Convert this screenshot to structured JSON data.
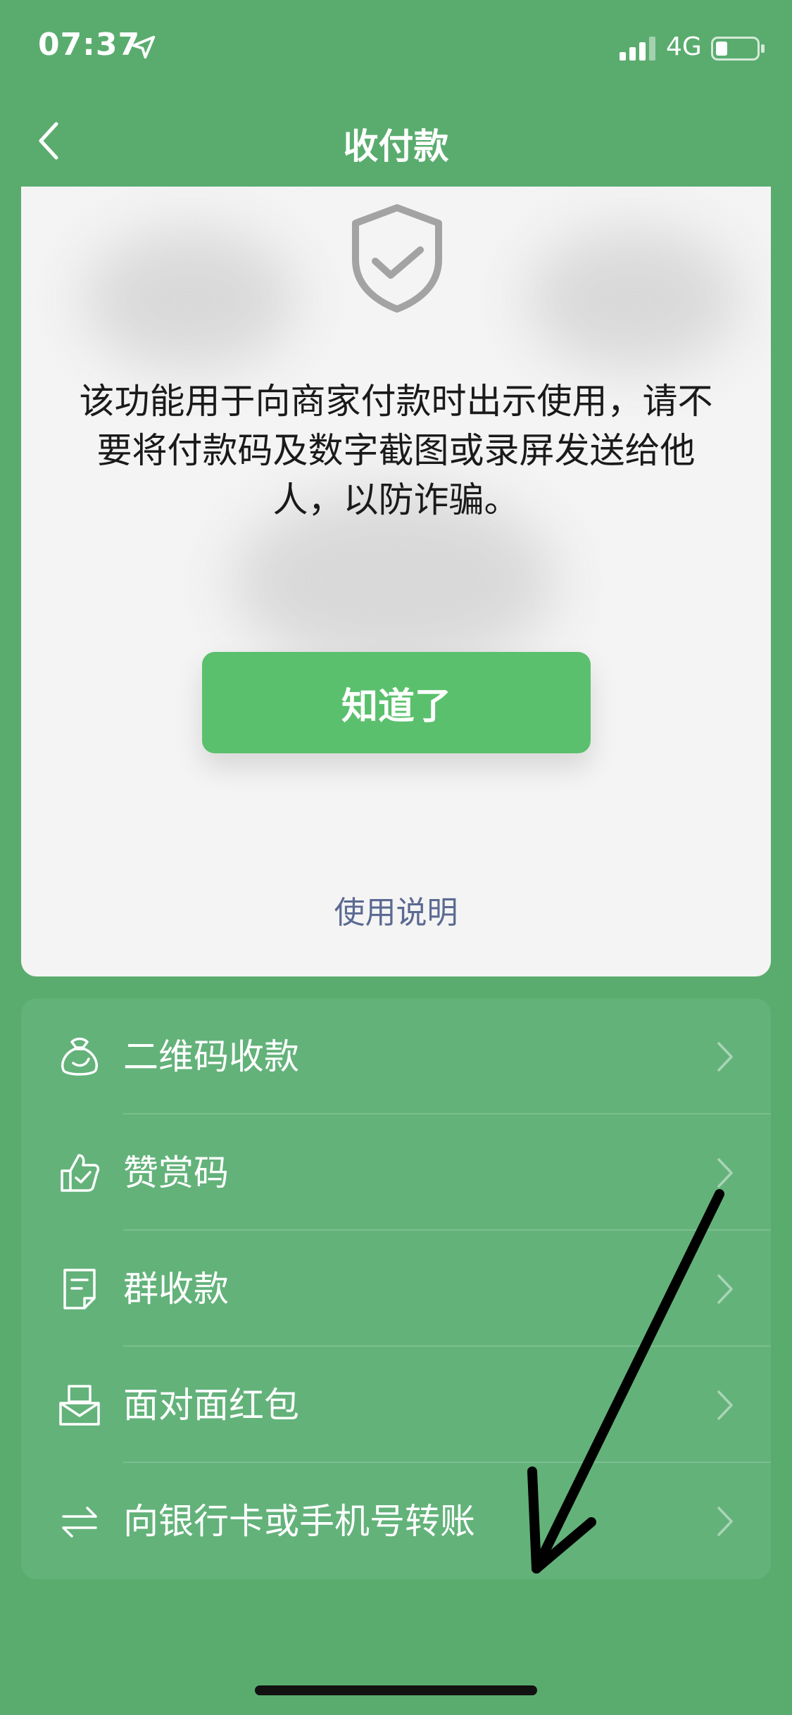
{
  "status_bar": {
    "time": "07:37",
    "network": "4G",
    "location_icon": "location-arrow-icon",
    "signal_icon": "cellular-signal-icon",
    "battery_icon": "battery-icon"
  },
  "nav": {
    "title": "收付款",
    "back_icon": "chevron-left-icon"
  },
  "notice": {
    "shield_icon": "shield-check-icon",
    "message": "该功能用于向商家付款时出示使用，请不要将付款码及数字截图或录屏发送给他人，以防诈骗。",
    "confirm_label": "知道了",
    "usage_link": "使用说明"
  },
  "menu": {
    "items": [
      {
        "label": "二维码收款",
        "icon": "money-bag-icon"
      },
      {
        "label": "赞赏码",
        "icon": "thumbs-up-icon"
      },
      {
        "label": "群收款",
        "icon": "receipt-icon"
      },
      {
        "label": "面对面红包",
        "icon": "red-packet-icon"
      },
      {
        "label": "向银行卡或手机号转账",
        "icon": "transfer-arrows-icon"
      }
    ]
  },
  "colors": {
    "background": "#5aac6e",
    "card_background": "#f4f4f4",
    "button_green": "#5bc06d",
    "menu_background": "#63b27a",
    "link_color": "#5b6a92"
  }
}
